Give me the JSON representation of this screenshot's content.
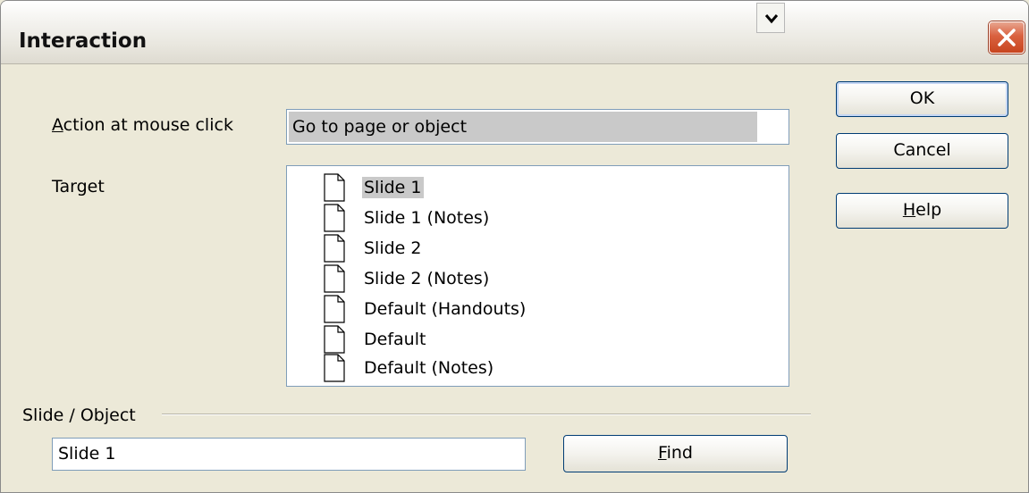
{
  "dialog": {
    "title": "Interaction"
  },
  "action": {
    "label": "Action at mouse click",
    "label_access_key": "A",
    "label_rest": "ction at mouse click",
    "selected_value": "Go to page or object"
  },
  "target": {
    "label": "Target",
    "items": [
      {
        "label": "Slide 1",
        "selected": true
      },
      {
        "label": "Slide 1 (Notes)",
        "selected": false
      },
      {
        "label": "Slide 2",
        "selected": false
      },
      {
        "label": "Slide 2 (Notes)",
        "selected": false
      },
      {
        "label": "Default (Handouts)",
        "selected": false
      },
      {
        "label": "Default",
        "selected": false
      },
      {
        "label": "Default (Notes)",
        "selected": false
      }
    ]
  },
  "slide_object": {
    "group_label": "Slide / Object",
    "value": "Slide 1",
    "find_label": "Find",
    "find_access_key": "F",
    "find_rest": "ind"
  },
  "buttons": {
    "ok_label": "OK",
    "cancel_label": "Cancel",
    "help_label": "Help",
    "help_access_key": "H",
    "help_rest": "elp"
  },
  "colors": {
    "dialog_bg": "#ece9d8",
    "selection_bg": "#c9c9c9",
    "close_button": "#d9613f",
    "field_border": "#7f9db9"
  }
}
